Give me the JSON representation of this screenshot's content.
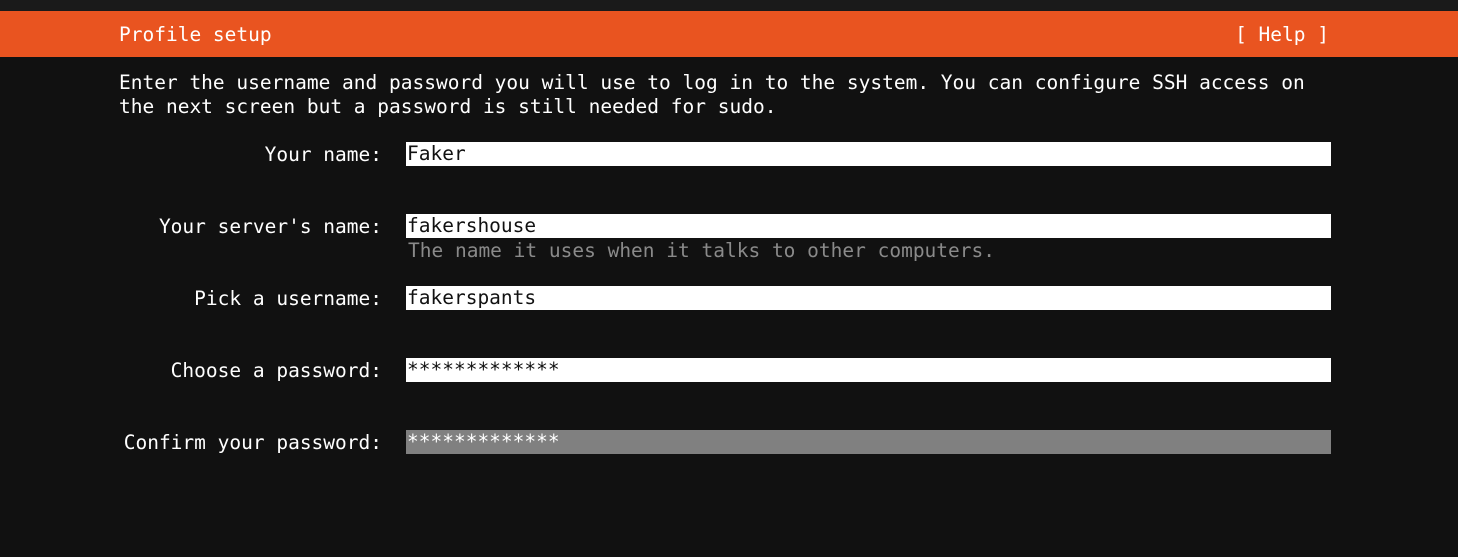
{
  "header": {
    "title": "Profile setup",
    "help_label": "[ Help ]",
    "color": "#e95420"
  },
  "intro": {
    "line1": "Enter the username and password you will use to log in to the system. You can configure SSH access on",
    "line2": "the next screen but a password is still needed for sudo."
  },
  "form": {
    "your_name": {
      "label": "Your name:",
      "value": "Faker"
    },
    "server_name": {
      "label": "Your server's name:",
      "value": "fakershouse",
      "hint": "The name it uses when it talks to other computers."
    },
    "username": {
      "label": "Pick a username:",
      "value": "fakerspants"
    },
    "password": {
      "label": "Choose a password:",
      "value": "*************"
    },
    "confirm_password": {
      "label": "Confirm your password:",
      "value": "*************",
      "focused": true
    }
  }
}
